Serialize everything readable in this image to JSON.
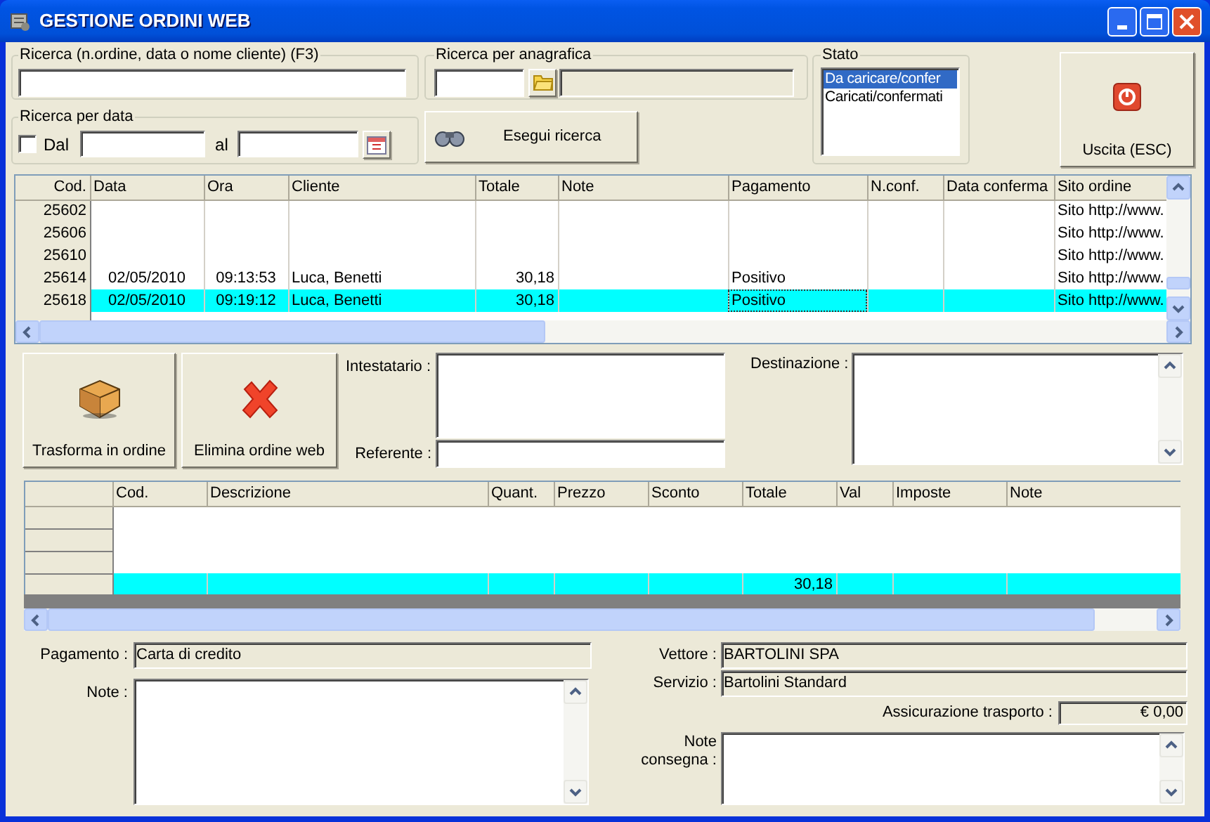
{
  "window": {
    "title": "GESTIONE ORDINI WEB"
  },
  "search": {
    "label": "Ricerca (n.ordine, data o nome cliente) (F3)"
  },
  "registry_search": {
    "label": "Ricerca per anagrafica"
  },
  "date_search": {
    "label": "Ricerca per data",
    "from_label": "Dal",
    "from_checked": false,
    "to_label": "al"
  },
  "search_button": {
    "label": "Esegui ricerca"
  },
  "status": {
    "label": "Stato",
    "items": [
      {
        "label": "Da caricare/confer",
        "selected": true
      },
      {
        "label": "Caricati/confermati",
        "selected": false
      }
    ]
  },
  "exit_button": {
    "label": "Uscita (ESC)"
  },
  "orders_table": {
    "columns": [
      "Cod.",
      "Data",
      "Ora",
      "Cliente",
      "Totale",
      "Note",
      "Pagamento",
      "N.conf.",
      "Data conferma",
      "Sito ordine"
    ],
    "rows": [
      {
        "cells": [
          "25602",
          null,
          null,
          null,
          null,
          null,
          null,
          null,
          null,
          "Sito http://www."
        ],
        "selected": false
      },
      {
        "cells": [
          "25606",
          null,
          null,
          null,
          null,
          null,
          null,
          null,
          null,
          "Sito http://www."
        ],
        "selected": false
      },
      {
        "cells": [
          "25610",
          null,
          null,
          null,
          null,
          null,
          null,
          null,
          null,
          "Sito http://www."
        ],
        "selected": false
      },
      {
        "cells": [
          "25614",
          "02/05/2010",
          "09:13:53",
          "Luca, Benetti",
          "30,18",
          null,
          "Positivo",
          null,
          null,
          "Sito http://www."
        ],
        "selected": false
      },
      {
        "cells": [
          "25618",
          "02/05/2010",
          "09:19:12",
          "Luca, Benetti",
          "30,18",
          null,
          "Positivo",
          null,
          null,
          "Sito http://www."
        ],
        "selected": true
      }
    ]
  },
  "actions": [
    {
      "kind": "convert",
      "label": "Trasforma in ordine"
    },
    {
      "kind": "delete",
      "label": "Elimina ordine web"
    }
  ],
  "holder": {
    "label": "Intestatario :"
  },
  "referent": {
    "label": "Referente :"
  },
  "destination": {
    "label": "Destinazione :"
  },
  "lines_table": {
    "columns": [
      "Cod.",
      "Descrizione",
      "Quant.",
      "Prezzo",
      "Sconto",
      "Totale",
      "Val",
      "Imposte",
      "Note"
    ],
    "rows": [
      {
        "selected": false
      },
      {
        "selected": false
      },
      {
        "selected": false
      },
      {
        "cells": [
          null,
          null,
          null,
          null,
          null,
          "30,18",
          null,
          null,
          null
        ],
        "selected": true
      }
    ]
  },
  "payment": {
    "label": "Pagamento :",
    "value": "Carta di credito"
  },
  "notes": {
    "label": "Note :"
  },
  "carrier": {
    "label": "Vettore :",
    "value": "BARTOLINI SPA"
  },
  "service": {
    "label": "Servizio :",
    "value": "Bartolini Standard"
  },
  "insurance": {
    "label": "Assicurazione trasporto :",
    "value": "€ 0,00"
  },
  "delivery_notes": {
    "label": "Note consegna :"
  }
}
